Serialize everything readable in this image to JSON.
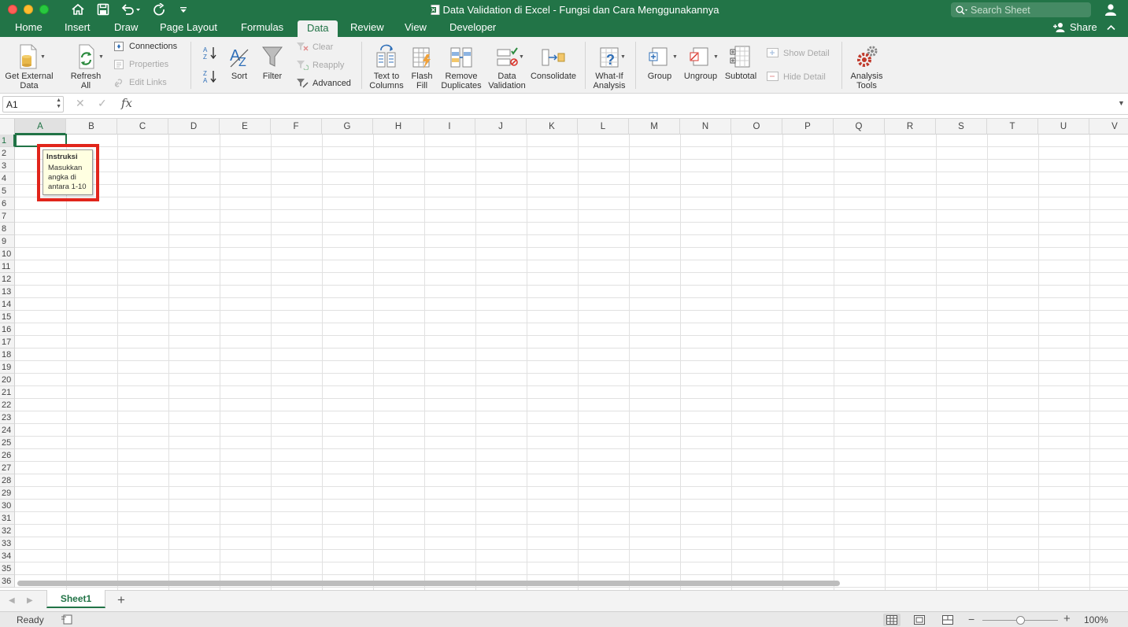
{
  "window": {
    "title": "Data Validation di Excel - Fungsi dan Cara Menggunakannya"
  },
  "search": {
    "placeholder": "Search Sheet"
  },
  "tabs": [
    {
      "label": "Home"
    },
    {
      "label": "Insert"
    },
    {
      "label": "Draw"
    },
    {
      "label": "Page Layout"
    },
    {
      "label": "Formulas"
    },
    {
      "label": "Data"
    },
    {
      "label": "Review"
    },
    {
      "label": "View"
    },
    {
      "label": "Developer"
    }
  ],
  "active_tab": "Data",
  "share_label": "Share",
  "ribbon": {
    "get_external_data": [
      "Get External",
      "Data"
    ],
    "refresh_all": [
      "Refresh",
      "All"
    ],
    "connections": "Connections",
    "properties": "Properties",
    "edit_links": "Edit Links",
    "sort": "Sort",
    "filter": "Filter",
    "clear": "Clear",
    "reapply": "Reapply",
    "advanced": "Advanced",
    "text_to_columns": [
      "Text to",
      "Columns"
    ],
    "flash_fill": [
      "Flash",
      "Fill"
    ],
    "remove_duplicates": [
      "Remove",
      "Duplicates"
    ],
    "data_validation": [
      "Data",
      "Validation"
    ],
    "consolidate": "Consolidate",
    "what_if": [
      "What-If",
      "Analysis"
    ],
    "group": "Group",
    "ungroup": "Ungroup",
    "subtotal": "Subtotal",
    "show_detail": "Show Detail",
    "hide_detail": "Hide Detail",
    "analysis_tools": [
      "Analysis",
      "Tools"
    ]
  },
  "formula_bar": {
    "name_box": "A1",
    "fx": "fx",
    "formula": ""
  },
  "columns": [
    "A",
    "B",
    "C",
    "D",
    "E",
    "F",
    "G",
    "H",
    "I",
    "J",
    "K",
    "L",
    "M",
    "N",
    "O",
    "P",
    "Q",
    "R",
    "S",
    "T",
    "U",
    "V"
  ],
  "rows": [
    "1",
    "2",
    "3",
    "4",
    "5",
    "6",
    "7",
    "8",
    "9",
    "10",
    "11",
    "12",
    "13",
    "14",
    "15",
    "16",
    "17",
    "18",
    "19",
    "20",
    "21",
    "22",
    "23",
    "24",
    "25",
    "26",
    "27",
    "28",
    "29",
    "30",
    "31",
    "32",
    "33",
    "34",
    "35",
    "36"
  ],
  "selected_cell": {
    "column": "A",
    "row": "1"
  },
  "input_message": {
    "title": "Instruksi",
    "lines": [
      "Masukkan",
      "angka di",
      "antara 1-10"
    ]
  },
  "sheets": [
    {
      "name": "Sheet1"
    }
  ],
  "status": {
    "text": "Ready",
    "zoom": "100%",
    "zoom_fraction": 0.5
  },
  "colors": {
    "brand": "#227447",
    "highlight": "#e1251b",
    "tooltip_bg": "#ffffe1"
  }
}
